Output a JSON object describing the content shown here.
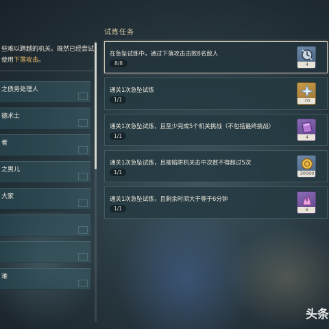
{
  "left_panel": {
    "intro_line1": "些难以跨越的机关。既然已经尝试",
    "intro_line2_prefix": "使用",
    "intro_line2_highlight": "下落攻击",
    "intro_line2_suffix": "。",
    "items": [
      {
        "label": "之债务处理人"
      },
      {
        "label": "德术士"
      },
      {
        "label": "者"
      },
      {
        "label": "之男儿"
      },
      {
        "label": "大家"
      },
      {
        "label": ""
      },
      {
        "label": ""
      },
      {
        "label": "难"
      }
    ]
  },
  "section_title": "试炼任务",
  "tasks": [
    {
      "title": "在急坠试炼中，通过下落攻击击败8名敌人",
      "progress": "8/8",
      "reward_icon": "clock-gear-icon",
      "reward_count": "4",
      "active": true
    },
    {
      "title": "通关1次急坠试炼",
      "progress": "1/1",
      "reward_icon": "primogem-star-icon",
      "reward_count": "70",
      "active": false
    },
    {
      "title": "通关1次急坠试炼，且至少完成5个机关挑战（不包括最终挑战）",
      "progress": "1/1",
      "reward_icon": "hero-wit-book-icon",
      "reward_count": "4",
      "active": false
    },
    {
      "title": "通关1次急坠试炼，且被陷阱机关击中次数不得超过5次",
      "progress": "1/1",
      "reward_icon": "mora-coin-icon",
      "reward_count": "30000",
      "active": false
    },
    {
      "title": "通关1次急坠试炼，且剩余时间大于等于6分钟",
      "progress": "1/1",
      "reward_icon": "crystal-ore-icon",
      "reward_count": "6",
      "active": false
    }
  ],
  "watermark": "头条"
}
